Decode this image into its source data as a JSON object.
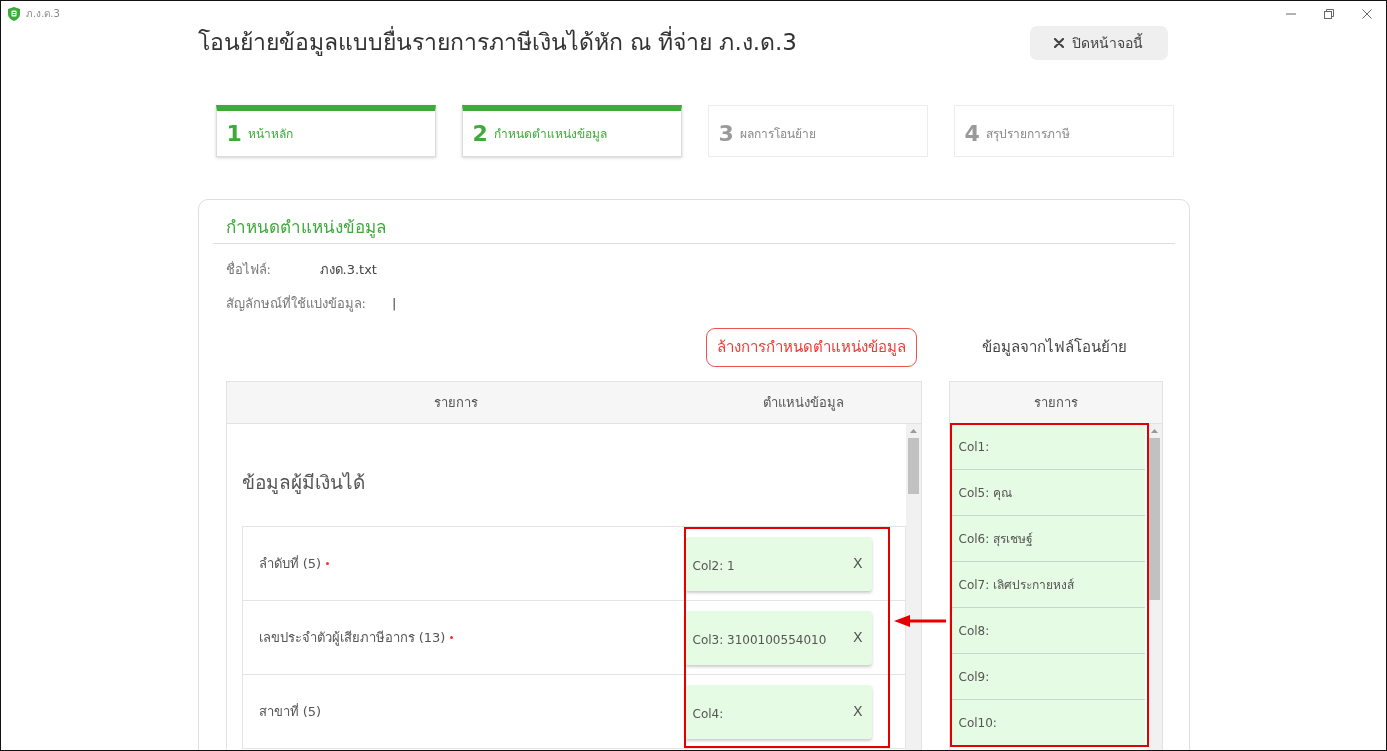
{
  "window": {
    "title": "ภ.ง.ด.3"
  },
  "page": {
    "title": "โอนย้ายข้อมูลแบบยื่นรายการภาษีเงินได้หัก ณ ที่จ่าย ภ.ง.ด.3",
    "close_button": "ปิดหน้าจอนี้"
  },
  "steps": [
    {
      "number": "1",
      "label": "หน้าหลัก",
      "active": true
    },
    {
      "number": "2",
      "label": "กำหนดตำแหน่งข้อมูล",
      "active": true
    },
    {
      "number": "3",
      "label": "ผลการโอนย้าย",
      "active": false
    },
    {
      "number": "4",
      "label": "สรุปรายการภาษี",
      "active": false
    }
  ],
  "panel": {
    "title": "กำหนดตำแหน่งข้อมูล",
    "file_info": [
      {
        "label": "ชื่อไฟล์:",
        "value": "ภงด.3.txt"
      },
      {
        "label": "สัญลักษณ์ที่ใช้แบ่งข้อมูล:",
        "value": "|"
      }
    ],
    "clear_button": "ล้างการกำหนดตำแหน่งข้อมูล",
    "mapping_table": {
      "columns": [
        "รายการ",
        "ตำแหน่งข้อมูล"
      ],
      "section_title": "ข้อมูลผู้มีเงินได้",
      "rows": [
        {
          "field": "ลำดับที่ (5)",
          "required": true,
          "mapped": {
            "text": "Col2: 1",
            "remove": "X"
          }
        },
        {
          "field": "เลขประจำตัวผู้เสียภาษีอากร (13)",
          "required": true,
          "mapped": {
            "text": "Col3: 3100100554010",
            "remove": "X"
          }
        },
        {
          "field": "สาขาที่ (5)",
          "required": false,
          "mapped": {
            "text": "Col4:",
            "remove": "X"
          }
        }
      ]
    },
    "source": {
      "title": "ข้อมูลจากไฟล์โอนย้าย",
      "column": "รายการ",
      "items": [
        "Col1:",
        "Col5: คุณ",
        "Col6: สุรเชษฐ์",
        "Col7: เลิศประกายหงส์",
        "Col8:",
        "Col9:",
        "Col10:"
      ]
    }
  }
}
